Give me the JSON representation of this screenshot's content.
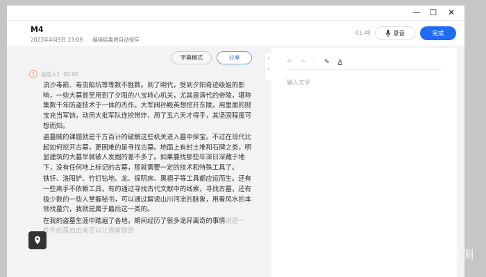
{
  "window": {
    "minimize": "—",
    "maximize": "☐",
    "close": "✕"
  },
  "header": {
    "title": "M4",
    "date": "2022年4月9日 23:09",
    "autosave": "编辑结果将自动保存",
    "duration": "01:48",
    "record_label": "录音",
    "done_label": "完成"
  },
  "toolbar": {
    "subtitle_mode": "字幕模式",
    "share": "分享"
  },
  "transcript": {
    "speaker_num": "1",
    "speaker": "说话人1",
    "timestamp": "00:00",
    "paragraphs": [
      "流沙毒箭、毒虫陷坑等等数不胜数。到了明代，受到夕阳奇迹级姐的影响，一些大墓甚至用到了夕阳的八宝转心机关，尤其是清代的帝陵，堪称集数千年防盗技术于一体的杰作。大军阀孙殿英想挖开东陵，用里面的财宝充当军饷，动用大批军队连挖带炸，用了五六天才得手，其坚固程度可想而知。",
      "盗墓贼的课题就是千方百计的破解这些机关进入墓中探宝。不过在现代比起如何挖开古墓，更困难的是寻找古墓。地面上有封土堆和石碑之类，明显建筑的大墓早就被人发掘的差不多了。如果要找那些年深日深藏于地下，没有任何地上标记的古墓，那就需要一定的技术和特殊工具了。",
      "铁钎、洛阳铲、竹钉钻地、龙、探阴床、黑褶子等工具都应运而生。还有一些高手不依赖工具，有的通过寻找古代文献中的线索，寻找古墓，还有极少数的一些人掌握秘书，可以通过解读山川河流的脉象，用看风水的本领找墓穴，我就是属于最后这一类的。"
    ],
    "last_main": "在我的盗墓生涯中踏遍了各地，期间经历了很多诡异离奇的事情",
    "last_faded": "说是一件件的恶自出来足以让观者惊奇"
  },
  "editor": {
    "placeholder": "输入文字",
    "undo": "↶",
    "redo": "↷",
    "highlight": "✎",
    "font_color": "A"
  },
  "watermark": "新浪众测"
}
